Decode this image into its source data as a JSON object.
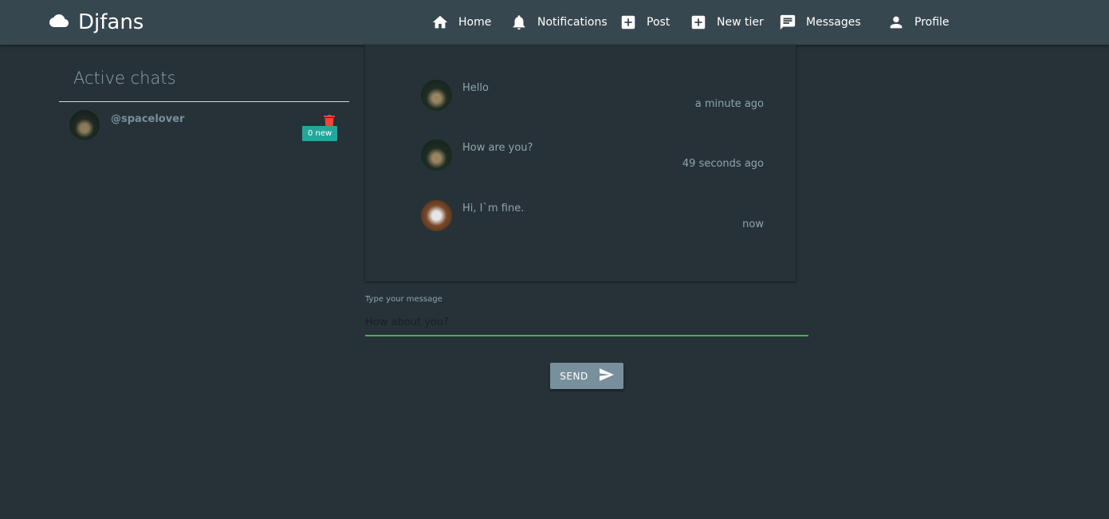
{
  "brand": {
    "name": "Djfans",
    "icon": "cloud-icon"
  },
  "nav": {
    "home": {
      "label": "Home",
      "icon": "home-icon"
    },
    "notifications": {
      "label": "Notifications",
      "icon": "bell-icon"
    },
    "post": {
      "label": "Post",
      "icon": "add-box-icon"
    },
    "new_tier": {
      "label": "New tier",
      "icon": "add-box-icon"
    },
    "messages": {
      "label": "Messages",
      "icon": "message-icon"
    },
    "profile": {
      "label": "Profile",
      "icon": "person-icon"
    }
  },
  "chats_panel": {
    "title": "Active chats",
    "items": [
      {
        "username": "@spacelover",
        "badge": "0 new"
      }
    ]
  },
  "messages": [
    {
      "text": "Hello",
      "time": "a minute ago"
    },
    {
      "text": "How are you?",
      "time": "49 seconds ago"
    },
    {
      "text": "Hi, I`m fine.",
      "time": "now"
    }
  ],
  "composer": {
    "label": "Type your message",
    "value": "How about you?",
    "send_label": "SEND"
  },
  "colors": {
    "background": "#263238",
    "navbar": "#37474f",
    "badge": "#26a69a",
    "input_underline": "#4caf50",
    "send_button": "#78909c",
    "delete": "#f44336"
  }
}
